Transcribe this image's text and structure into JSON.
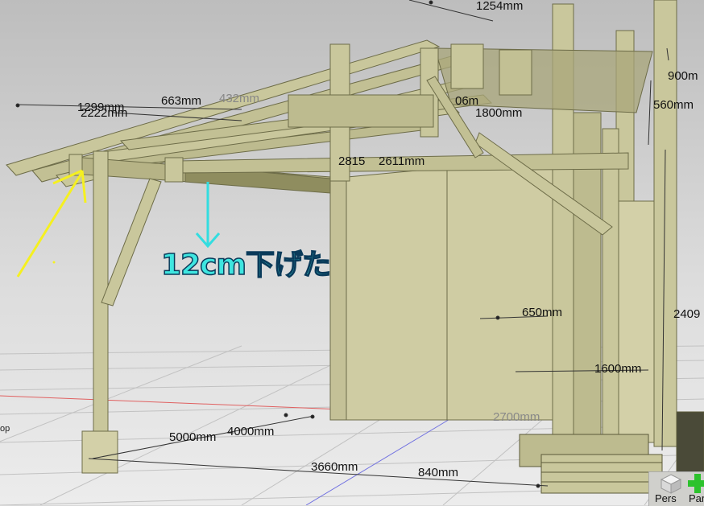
{
  "viewport": {
    "annotation": "12cm下げた",
    "dimensions": {
      "d1254": "1254mm",
      "d1299": "1299mm",
      "d2222": "2222mm",
      "d663": "663mm",
      "d432": "432mm",
      "d06": "06m",
      "d1800": "1800mm",
      "d900": "900m",
      "d560": "560mm",
      "d2815": "2815",
      "d2611": "2611mm",
      "d650": "650mm",
      "d2409": "2409",
      "d1600": "1600mm",
      "d2700": "2700mm",
      "d5000": "5000mm",
      "d4000": "4000mm",
      "d3660": "3660mm",
      "d840": "840mm",
      "top": "op"
    }
  },
  "view_widget": {
    "pers_label": "Pers",
    "par_label": "Par",
    "pers_icon": "cube-icon",
    "par_icon": "plus-icon"
  },
  "colors": {
    "wood": "#c9c79c",
    "wood_dark": "#8b8a5c",
    "background": "#d8d8d8",
    "annotation": "#3ee6e0",
    "arrow_yellow": "#f5f020",
    "arrow_cyan": "#33dde0",
    "plus_green": "#2cc22c"
  }
}
